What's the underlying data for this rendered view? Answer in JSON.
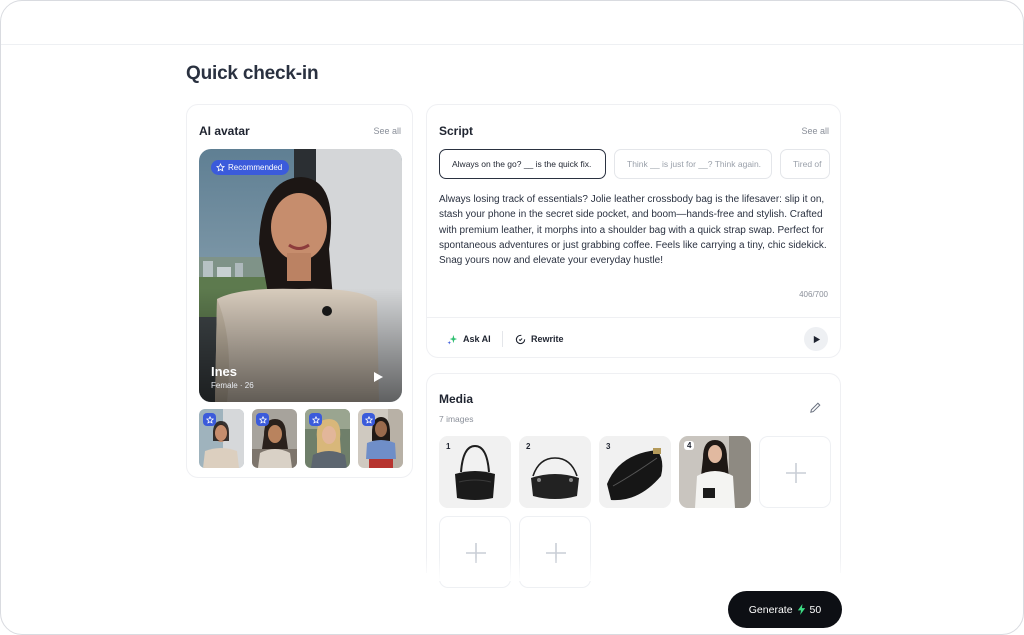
{
  "page": {
    "title": "Quick check-in"
  },
  "avatar_section": {
    "title": "AI avatar",
    "see_all": "See all",
    "badge": "Recommended",
    "selected": {
      "name": "Ines",
      "meta": "Female · 26"
    },
    "thumbnails": [
      "avatar-1",
      "avatar-2",
      "avatar-3",
      "avatar-4"
    ]
  },
  "script_section": {
    "title": "Script",
    "see_all": "See all",
    "hooks": [
      "Always on the go? __ is the quick fix.",
      "Think __ is just for __? Think again.",
      "Tired of"
    ],
    "body": "Always losing track of essentials? Jolie leather crossbody bag is the lifesaver: slip it on, stash your phone in the secret side pocket, and boom—hands-free and stylish. Crafted with premium leather, it morphs into a shoulder bag with a quick strap swap. Perfect for spontaneous adventures or just grabbing coffee. Feels like carrying a tiny, chic sidekick. Snag yours now and elevate your everyday hustle!",
    "counter": "406/700",
    "ask_ai": "Ask AI",
    "rewrite": "Rewrite"
  },
  "media_section": {
    "title": "Media",
    "count": "7 images",
    "items": [
      "1",
      "2",
      "3",
      "4"
    ]
  },
  "generate": {
    "label": "Generate",
    "credits": "50"
  },
  "colors": {
    "accent": "#3b5bdb",
    "credit_bolt": "#3ddc84",
    "button_dark": "#0d0f14"
  }
}
